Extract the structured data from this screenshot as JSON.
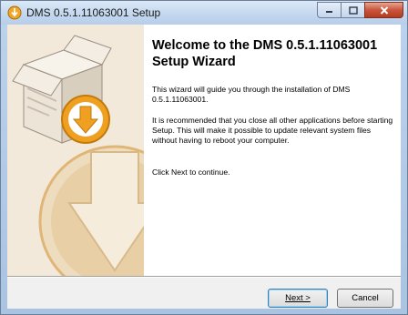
{
  "window": {
    "title": "DMS 0.5.1.11063001 Setup"
  },
  "caption_buttons": {
    "minimize": "minimize-icon",
    "maximize": "maximize-icon",
    "close": "close-icon"
  },
  "content": {
    "heading": "Welcome to the DMS 0.5.1.11063001 Setup Wizard",
    "paragraph_1": "This wizard will guide you through the installation of DMS 0.5.1.11063001.",
    "paragraph_2": "It is recommended that you close all other applications before starting Setup. This will make it possible to update relevant system files without having to reboot your computer.",
    "paragraph_3": "Click Next to continue."
  },
  "buttons": {
    "next": "Next >",
    "cancel": "Cancel"
  },
  "colors": {
    "accent_orange": "#f0a020",
    "panel_beige": "#f2e9da"
  }
}
